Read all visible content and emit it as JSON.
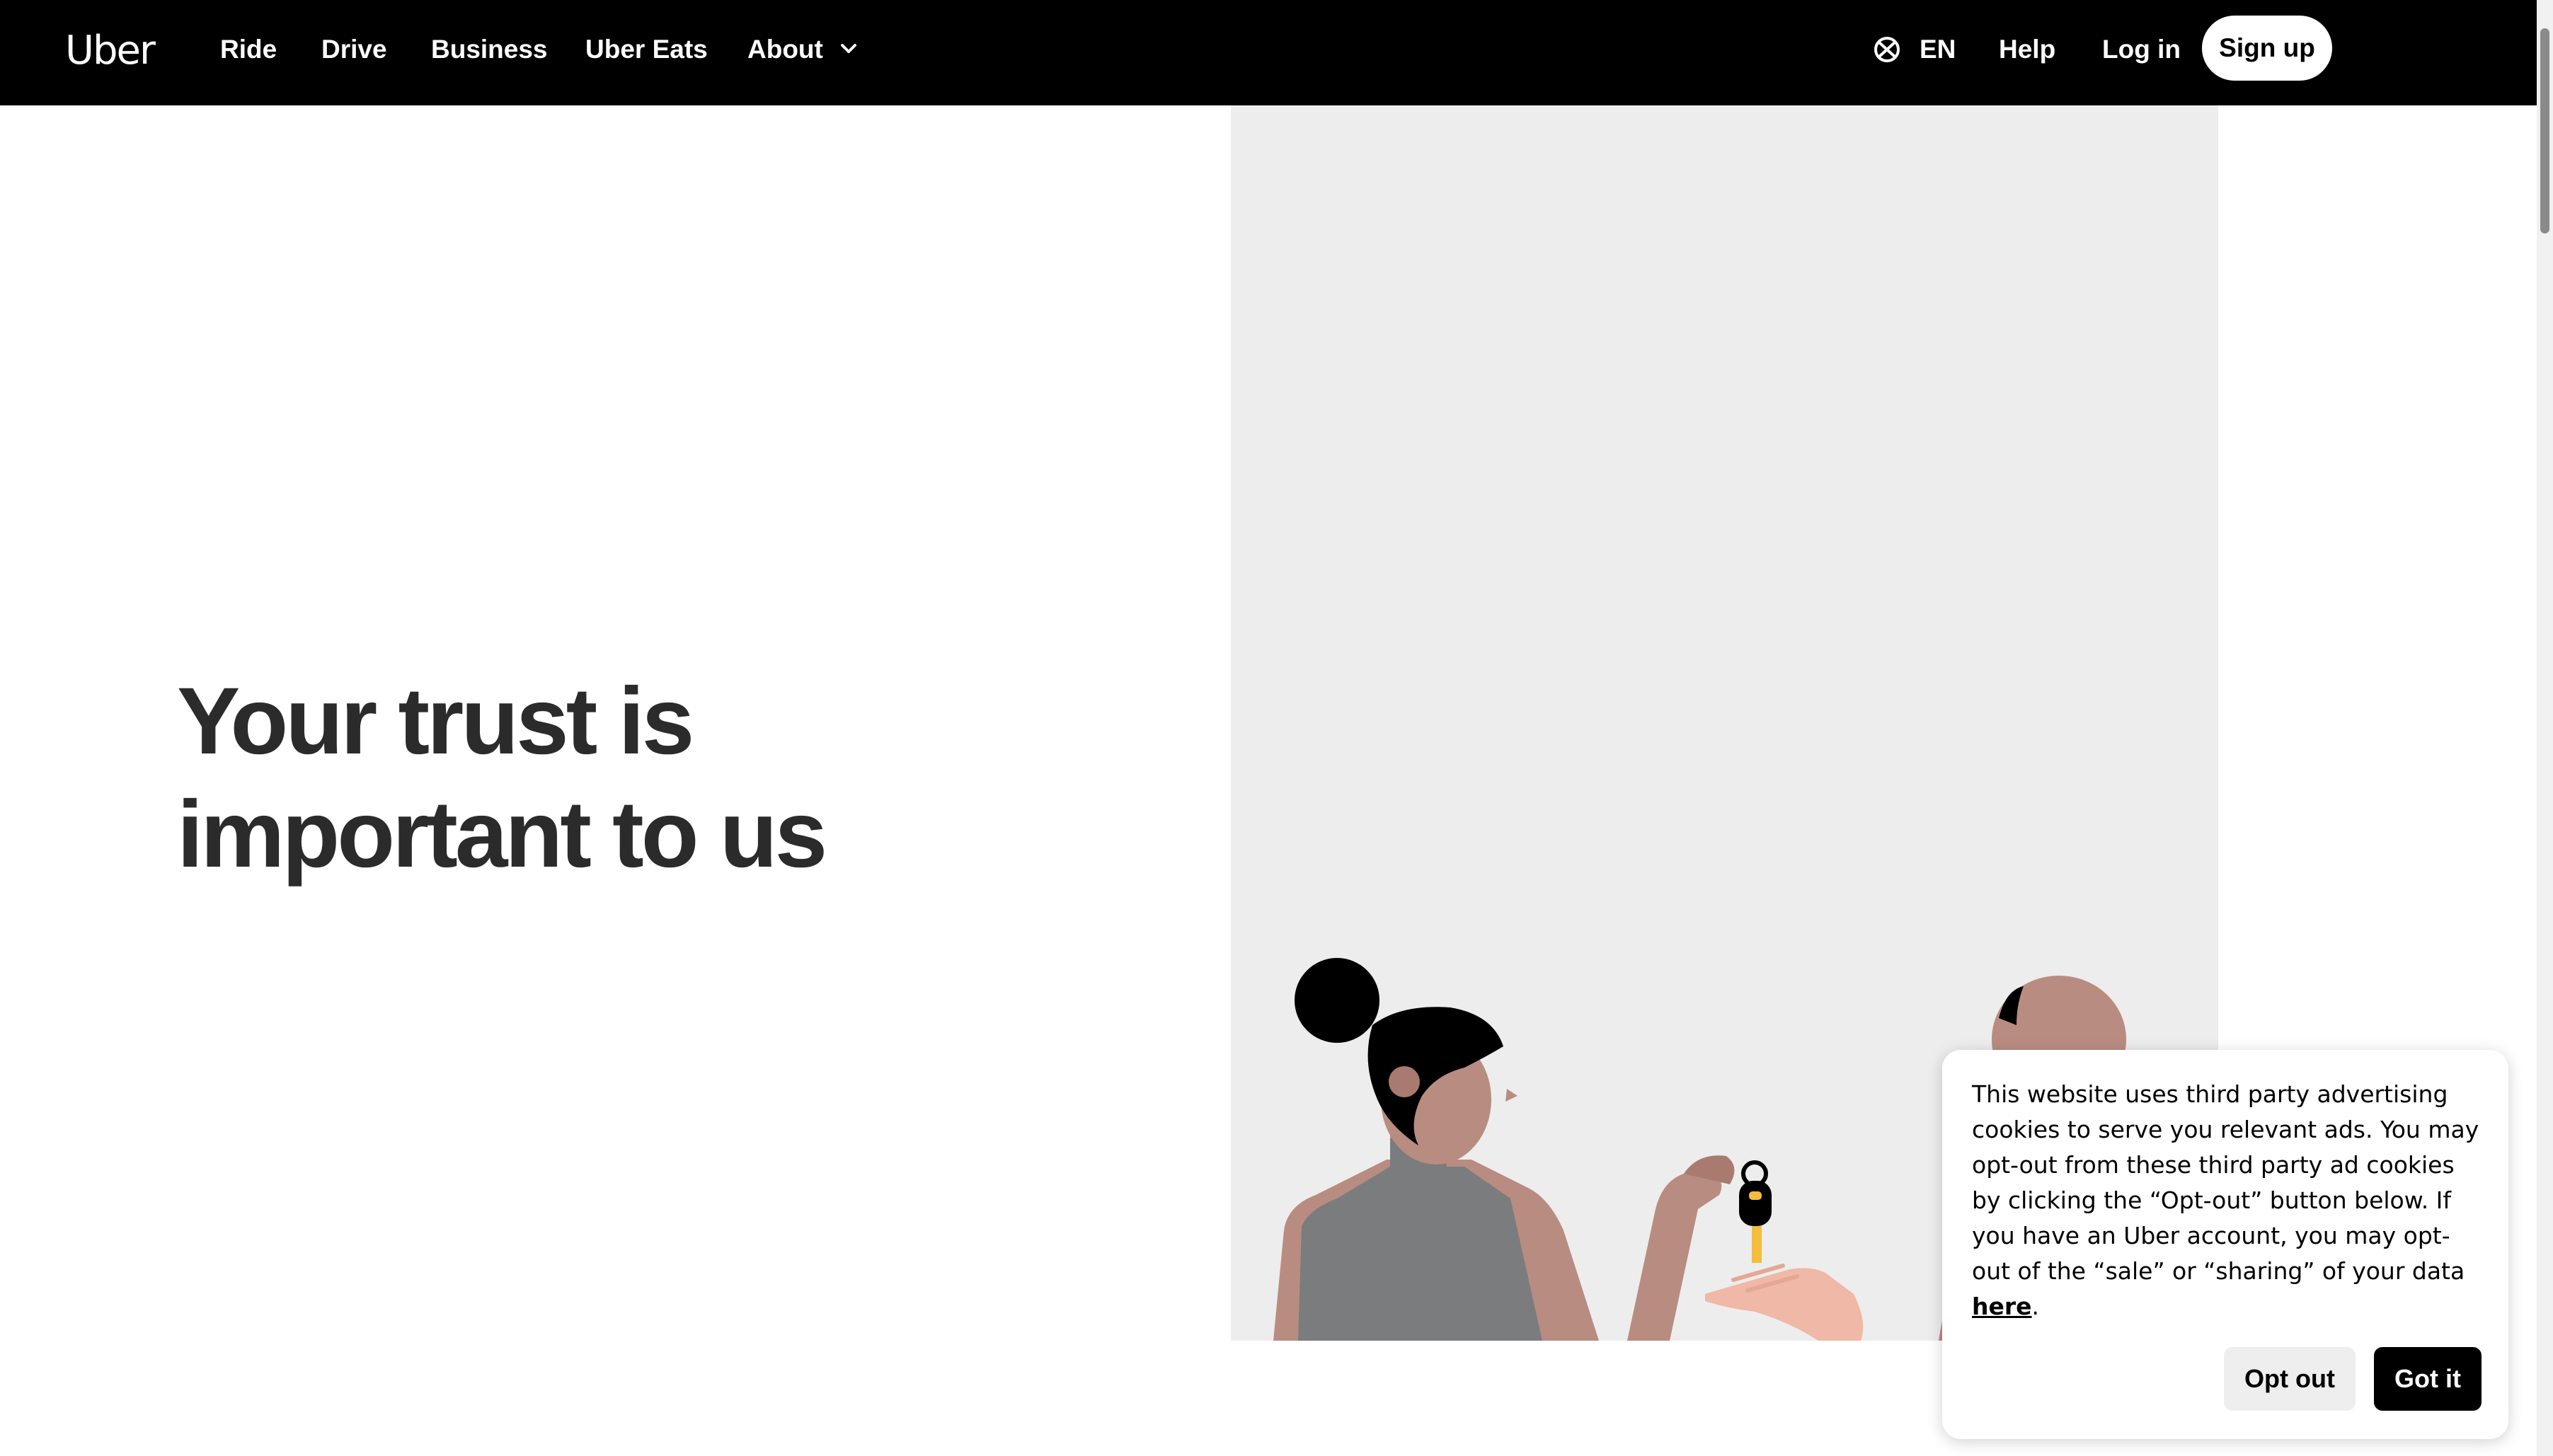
{
  "header": {
    "logo": "Uber",
    "nav": {
      "ride": "Ride",
      "drive": "Drive",
      "business": "Business",
      "uber_eats": "Uber Eats",
      "about": "About"
    },
    "language": "EN",
    "help": "Help",
    "login": "Log in",
    "signup": "Sign up"
  },
  "hero": {
    "title_line1": "Your trust is",
    "title_line2": "important to us"
  },
  "cookie_banner": {
    "text": "This website uses third party advertising cookies to serve you relevant ads. You may opt-out from these third party ad cookies by clicking the “Opt-out” button below. If you have an Uber account, you may opt-out of the “sale” or “sharing” of your data ",
    "link_text": "here",
    "end_punct": ".",
    "opt_out_button": "Opt out",
    "got_it_button": "Got it"
  },
  "colors": {
    "nav_background": "#000000",
    "hero_panel": "#ededed",
    "title_text": "#2b2b2b"
  },
  "icons": {
    "language": "globe-icon",
    "dropdown": "chevron-down-icon"
  }
}
